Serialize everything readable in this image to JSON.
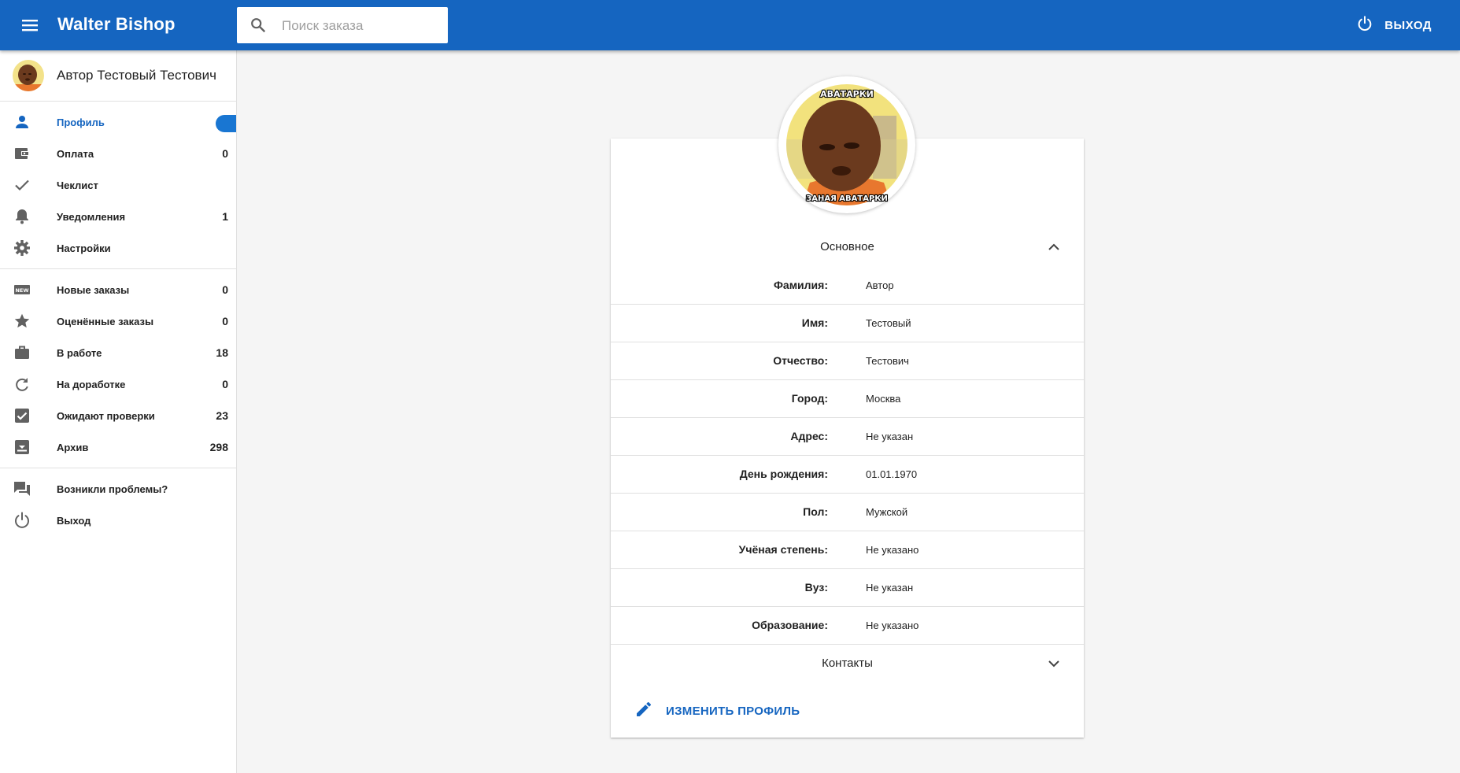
{
  "topbar": {
    "title": "Walter Bishop",
    "search_placeholder": "Поиск заказа",
    "logout_label": "ВЫХОД"
  },
  "sidebar": {
    "user_name": "Автор Тестовый Тестович",
    "primary_items": [
      {
        "label": "Профиль",
        "count": "",
        "icon": "person-icon",
        "active": true
      },
      {
        "label": "Оплата",
        "count": "0",
        "icon": "wallet-icon"
      },
      {
        "label": "Чеклист",
        "count": "",
        "icon": "check-icon"
      },
      {
        "label": "Уведомления",
        "count": "1",
        "icon": "bell-icon"
      },
      {
        "label": "Настройки",
        "count": "",
        "icon": "gear-icon"
      }
    ],
    "order_items": [
      {
        "label": "Новые заказы",
        "count": "0",
        "icon": "new-icon"
      },
      {
        "label": "Оценённые заказы",
        "count": "0",
        "icon": "star-icon"
      },
      {
        "label": "В работе",
        "count": "18",
        "icon": "briefcase-icon"
      },
      {
        "label": "На доработке",
        "count": "0",
        "icon": "refresh-icon"
      },
      {
        "label": "Ожидают проверки",
        "count": "23",
        "icon": "checkbox-icon"
      },
      {
        "label": "Архив",
        "count": "298",
        "icon": "archive-icon"
      }
    ],
    "help_items": [
      {
        "label": "Возникли проблемы?",
        "icon": "forum-icon"
      },
      {
        "label": "Выход",
        "icon": "power-icon"
      }
    ]
  },
  "profile": {
    "section_main": "Основное",
    "fields": [
      {
        "label": "Фамилия:",
        "value": "Автор"
      },
      {
        "label": "Имя:",
        "value": "Тестовый"
      },
      {
        "label": "Отчество:",
        "value": "Тестович"
      },
      {
        "label": "Город:",
        "value": "Москва"
      },
      {
        "label": "Адрес:",
        "value": "Не указан"
      },
      {
        "label": "День рождения:",
        "value": "01.01.1970"
      },
      {
        "label": "Пол:",
        "value": "Мужской"
      },
      {
        "label": "Учёная степень:",
        "value": "Не указано"
      },
      {
        "label": "Вуз:",
        "value": "Не указан"
      },
      {
        "label": "Образование:",
        "value": "Не указано"
      }
    ],
    "section_contacts": "Контакты",
    "edit_label": "ИЗМЕНИТЬ ПРОФИЛЬ",
    "avatar_caption_top": "АВАТАРКИ",
    "avatar_caption_bottom": "ЗАНАЯ АВАТАРКИ"
  },
  "colors": {
    "primary": "#1565c0",
    "accent": "#1976d2"
  }
}
